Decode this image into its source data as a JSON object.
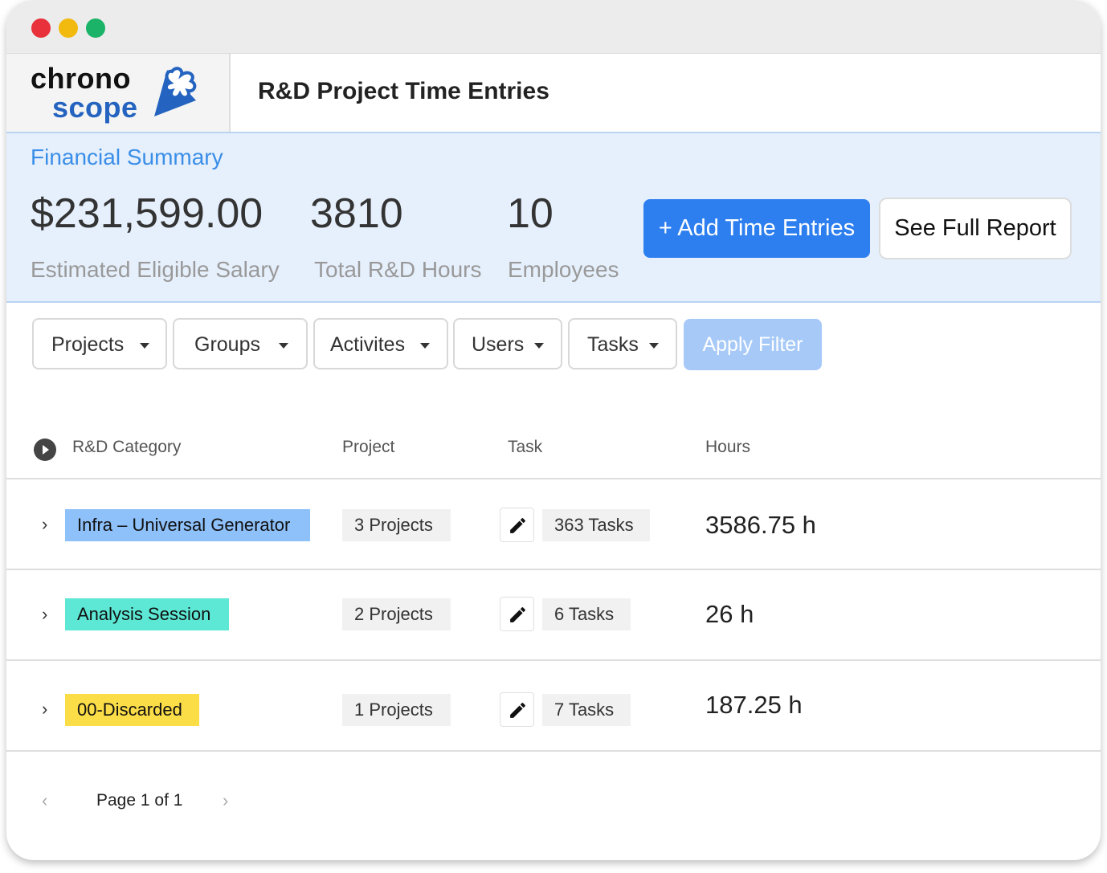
{
  "app": {
    "logo_line1": "chrono",
    "logo_line2": "scope",
    "page_title": "R&D Project Time Entries"
  },
  "summary": {
    "label": "Financial Summary",
    "salary_value": "$231,599.00",
    "salary_label": "Estimated Eligible Salary",
    "hours_value": "3810",
    "hours_label": "Total R&D Hours",
    "employees_value": "10",
    "employees_label": "Employees",
    "add_button": "+ Add Time Entries",
    "report_button": "See Full Report"
  },
  "filters": {
    "items": [
      "Projects",
      "Groups",
      "Activites",
      "Users",
      "Tasks"
    ],
    "apply": "Apply Filter"
  },
  "table": {
    "headers": [
      "R&D Category",
      "Project",
      "Task",
      "Hours"
    ],
    "rows": [
      {
        "category": "Infra – Universal Generator",
        "category_color": "#8ec0f9",
        "projects": "3 Projects",
        "tasks": "363 Tasks",
        "hours": "3586.75 h"
      },
      {
        "category": "Analysis Session",
        "category_color": "#5ce8d4",
        "projects": "2 Projects",
        "tasks": "6 Tasks",
        "hours": "26 h"
      },
      {
        "category": "00-Discarded",
        "category_color": "#fbdd48",
        "projects": "1 Projects",
        "tasks": "7 Tasks",
        "hours": "187.25 h"
      }
    ]
  },
  "pagination": {
    "text": "Page 1 of 1",
    "prev": "‹",
    "next": "›"
  },
  "colors": {
    "accent": "#2d7ff0",
    "summary_bg": "#e6f0fc",
    "apply_disabled": "#a6c9f8"
  }
}
